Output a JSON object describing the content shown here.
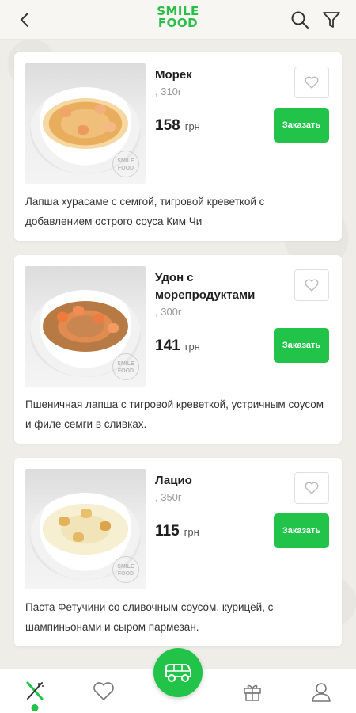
{
  "header": {
    "logo_line1": "SMILE",
    "logo_line2": "FOOD",
    "back_icon": "back-arrow-icon",
    "search_icon": "search-icon",
    "filter_icon": "filter-icon"
  },
  "colors": {
    "accent": "#21c449",
    "logo": "#2bbf4a"
  },
  "items": [
    {
      "title": "Морек",
      "weight": ", 310г",
      "price": "158",
      "currency": "грн",
      "order_label": "Заказать",
      "description": "Лапша хурасаме с семгой, тигровой креветкой с добавлением острого соуса Ким Чи",
      "stamp": "SMILE FOOD"
    },
    {
      "title": "Удон с морепродуктами",
      "weight": ", 300г",
      "price": "141",
      "currency": "грн",
      "order_label": "Заказать",
      "description": "Пшеничная лапша с тигровой креветкой, устричным соусом и филе семги в сливках.",
      "stamp": "SMILE FOOD"
    },
    {
      "title": "Лацио",
      "weight": ", 350г",
      "price": "115",
      "currency": "грн",
      "order_label": "Заказать",
      "description": "Паста Фетучини со сливочным соусом, курицей, с шампиньонами и сыром пармезан.",
      "stamp": "SMILE FOOD"
    }
  ],
  "bottom_nav": {
    "items": [
      "menu-icon",
      "heart-icon",
      "gift-icon",
      "profile-icon"
    ],
    "fab_icon": "delivery-car-icon"
  }
}
